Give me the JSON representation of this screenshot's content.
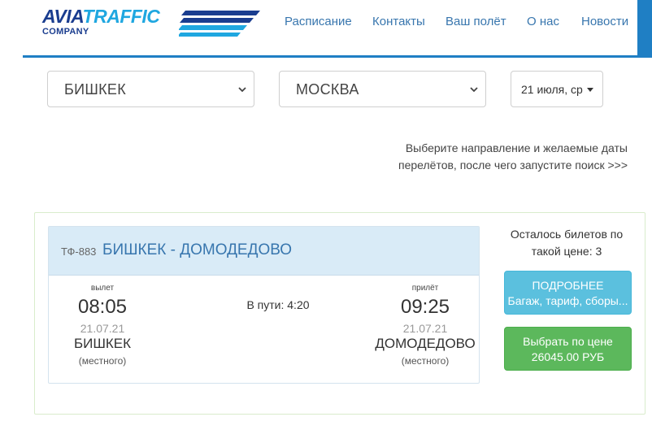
{
  "brand": {
    "name_part1": "AVIA",
    "name_part2": "TRAFFIC",
    "subtitle": "COMPANY",
    "color_primary": "#1a3d8f",
    "color_accent": "#1fa7e0"
  },
  "nav": {
    "items": [
      {
        "label": "Расписание"
      },
      {
        "label": "Контакты"
      },
      {
        "label": "Ваш полёт"
      },
      {
        "label": "О нас"
      },
      {
        "label": "Новости"
      }
    ],
    "accent_color": "#1f7fc4"
  },
  "search": {
    "from": {
      "value": "БИШКЕК",
      "icon": "chevron-down-icon"
    },
    "to": {
      "value": "МОСКВА",
      "icon": "chevron-down-icon"
    },
    "date": {
      "value": "21 июля, ср",
      "icon": "caret-down-icon"
    },
    "hint_line1": "Выберите направление и желаемые даты",
    "hint_line2": "перелётов, после чего запустите поиск >>>"
  },
  "flight": {
    "number": "ТФ-883",
    "route": "БИШКЕК - ДОМОДЕДОВО",
    "departure": {
      "label": "вылет",
      "time": "08:05",
      "date": "21.07.21",
      "city": "БИШКЕК",
      "note": "(местного)"
    },
    "duration": "В пути: 4:20",
    "arrival": {
      "label": "прилёт",
      "time": "09:25",
      "date": "21.07.21",
      "city": "ДОМОДЕДОВО",
      "note": "(местного)"
    },
    "tickets_left_line1": "Осталось билетов по",
    "tickets_left_line2": "такой цене: 3",
    "details_button_line1": "ПОДРОБНЕЕ",
    "details_button_line2": "Багаж, тариф, сборы...",
    "select_button_line1": "Выбрать по цене",
    "select_button_line2": "26045.00 РУБ",
    "colors": {
      "info": "#5bc0de",
      "success": "#5cb85c",
      "route": "#3876ae"
    }
  }
}
